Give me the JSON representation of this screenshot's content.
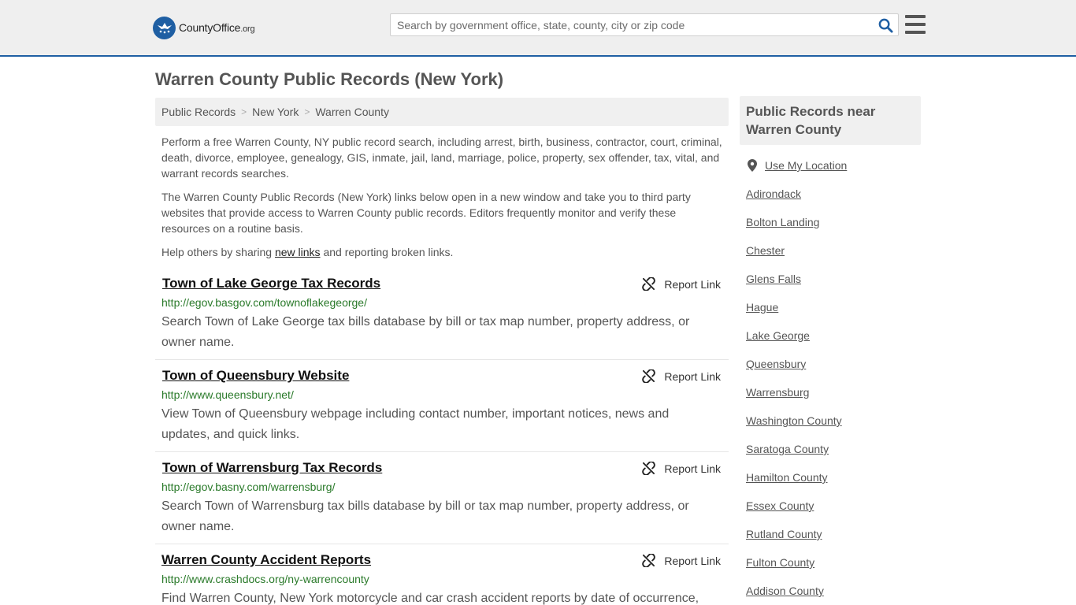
{
  "header": {
    "logo_text": "CountyOffice",
    "logo_tld": ".org",
    "search_placeholder": "Search by government office, state, county, city or zip code"
  },
  "page": {
    "title": "Warren County Public Records (New York)"
  },
  "breadcrumb": [
    "Public Records",
    "New York",
    "Warren County"
  ],
  "intro": {
    "p1": "Perform a free Warren County, NY public record search, including arrest, birth, business, contractor, court, criminal, death, divorce, employee, genealogy, GIS, inmate, jail, land, marriage, police, property, sex offender, tax, vital, and warrant records searches.",
    "p2": "The Warren County Public Records (New York) links below open in a new window and take you to third party websites that provide access to Warren County public records. Editors frequently monitor and verify these resources on a routine basis.",
    "p3_before": "Help others by sharing ",
    "p3_link": "new links",
    "p3_after": " and reporting broken links."
  },
  "report_label": "Report Link",
  "records": [
    {
      "title": "Town of Lake George Tax Records",
      "url": "http://egov.basgov.com/townoflakegeorge/",
      "desc": "Search Town of Lake George tax bills database by bill or tax map number, property address, or owner name."
    },
    {
      "title": "Town of Queensbury Website",
      "url": "http://www.queensbury.net/",
      "desc": "View Town of Queensbury webpage including contact number, important notices, news and updates, and quick links."
    },
    {
      "title": "Town of Warrensburg Tax Records",
      "url": "http://egov.basny.com/warrensburg/",
      "desc": "Search Town of Warrensburg tax bills database by bill or tax map number, property address, or owner name."
    },
    {
      "title": "Warren County Accident Reports",
      "url": "http://www.crashdocs.org/ny-warrencounty",
      "desc": "Find Warren County, New York motorcycle and car crash accident reports by date of occurrence,"
    }
  ],
  "sidebar": {
    "title": "Public Records near Warren County",
    "use_location": "Use My Location",
    "items": [
      "Adirondack",
      "Bolton Landing",
      "Chester",
      "Glens Falls",
      "Hague",
      "Lake George",
      "Queensbury",
      "Warrensburg",
      "Washington County",
      "Saratoga County",
      "Hamilton County",
      "Essex County",
      "Rutland County",
      "Fulton County",
      "Addison County"
    ]
  },
  "colors": {
    "brand_blue": "#1f5fa3",
    "url_green": "#2a7a2a"
  }
}
